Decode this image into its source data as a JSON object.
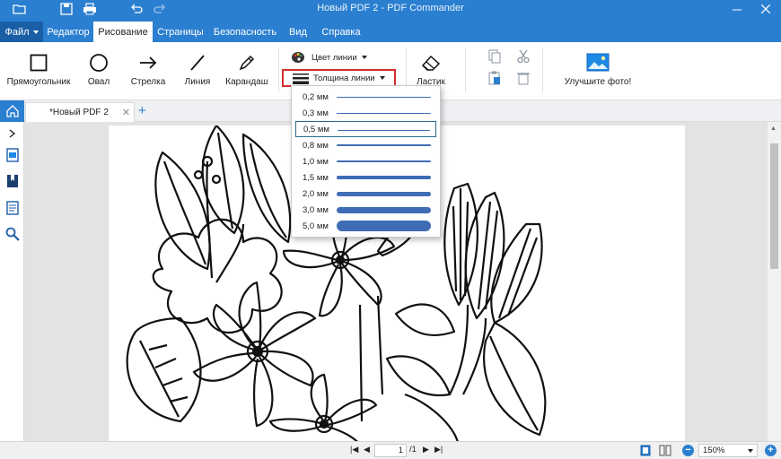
{
  "titlebar": {
    "title": "Новый PDF 2 - PDF Commander",
    "quick_access": [
      "folder-icon",
      "save-icon",
      "print-icon",
      "undo-icon",
      "redo-icon"
    ]
  },
  "menu": {
    "file_label": "Файл",
    "tabs": [
      {
        "label": "Редактор"
      },
      {
        "label": "Рисование",
        "active": true
      },
      {
        "label": "Страницы"
      },
      {
        "label": "Безопасность"
      },
      {
        "label": "Вид"
      },
      {
        "label": "Справка"
      }
    ]
  },
  "ribbon": {
    "tools": [
      {
        "label": "Прямоугольник",
        "icon": "rectangle-icon"
      },
      {
        "label": "Овал",
        "icon": "oval-icon"
      },
      {
        "label": "Стрелка",
        "icon": "arrow-icon"
      },
      {
        "label": "Линия",
        "icon": "line-icon"
      },
      {
        "label": "Карандаш",
        "icon": "pencil-icon"
      }
    ],
    "line_color_label": "Цвет линии",
    "line_width_label": "Толщина линии",
    "eraser_label": "Ластик",
    "enhance_photo_label": "Улучшите фото!"
  },
  "line_width_options": [
    {
      "label": "0,2 мм",
      "value": 0.2
    },
    {
      "label": "0,3 мм",
      "value": 0.3
    },
    {
      "label": "0,5 мм",
      "value": 0.5,
      "selected": true
    },
    {
      "label": "0,8 мм",
      "value": 0.8
    },
    {
      "label": "1,0 мм",
      "value": 1.0
    },
    {
      "label": "1,5 мм",
      "value": 1.5
    },
    {
      "label": "2,0 мм",
      "value": 2.0
    },
    {
      "label": "3,0 мм",
      "value": 3.0
    },
    {
      "label": "5,0 мм",
      "value": 5.0
    }
  ],
  "document": {
    "tab_label": "*Новый PDF 2",
    "add_tab": "+",
    "close_tab": "✕"
  },
  "statusbar": {
    "page_current": "1",
    "page_total": "/1",
    "zoom": "150%"
  },
  "colors": {
    "accent": "#2b7fd0",
    "highlight_border": "#d32f2f",
    "line_sample": "#3f6cb4"
  }
}
